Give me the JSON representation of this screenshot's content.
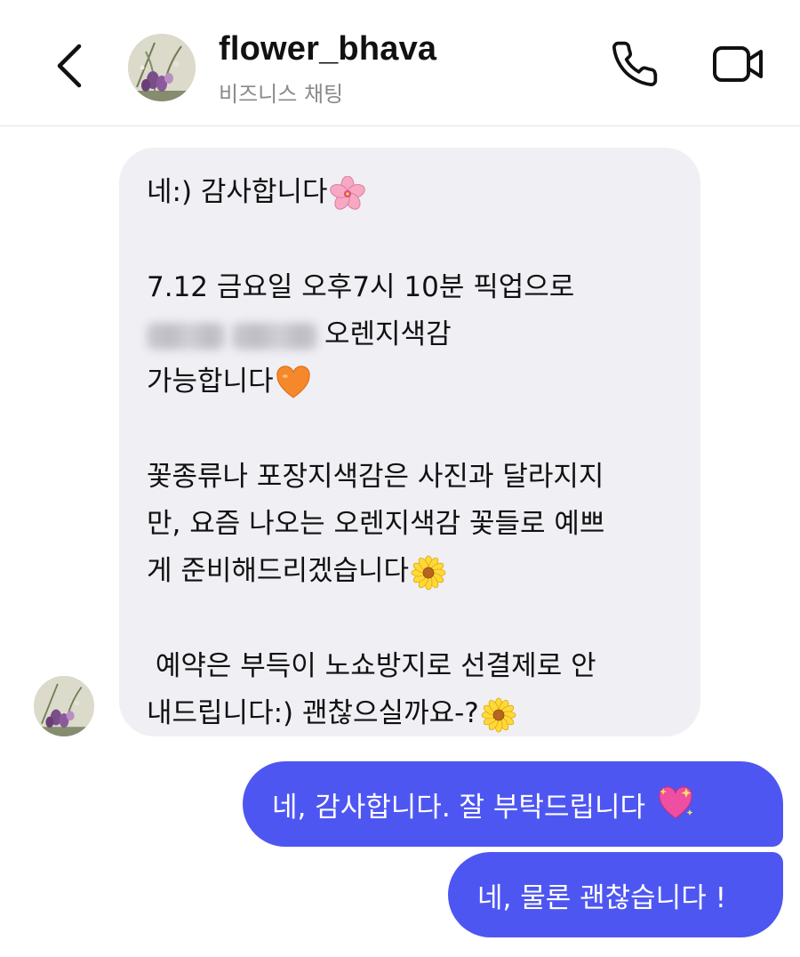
{
  "header": {
    "name": "flower_bhava",
    "subtitle": "비즈니스 채팅"
  },
  "icons": {
    "back": "chevron-left-icon",
    "call": "phone-icon",
    "video": "video-camera-icon"
  },
  "incoming_message": {
    "lines": {
      "l1": "네:) 감사합니다",
      "l2": "7.12 금요일 오후7시 10분 픽업으로",
      "l3_suffix": "오렌지색감",
      "l4": "가능합니다",
      "l5": "꽃종류나 포장지색감은 사진과 달라지지",
      "l6": "만, 요즘 나오는 오렌지색감 꽃들로 예쁘",
      "l7": "게 준비해드리겠습니다",
      "l8": " 예약은 부득이 노쇼방지로 선결제로 안",
      "l9": "내드립니다:) 괜찮으실까요-?"
    },
    "emojis": [
      "cherry-blossom",
      "orange-heart",
      "blossom",
      "blossom"
    ]
  },
  "outgoing_messages": [
    {
      "text": "네, 감사합니다. 잘 부탁드립니다 ",
      "emoji": "sparkling-heart"
    },
    {
      "text": "네, 물론 괜찮습니다 !"
    }
  ],
  "colors": {
    "outgoing_bubble": "#4e56f2",
    "incoming_bubble": "#efeff4",
    "subtitle_gray": "#8a8a8a"
  }
}
